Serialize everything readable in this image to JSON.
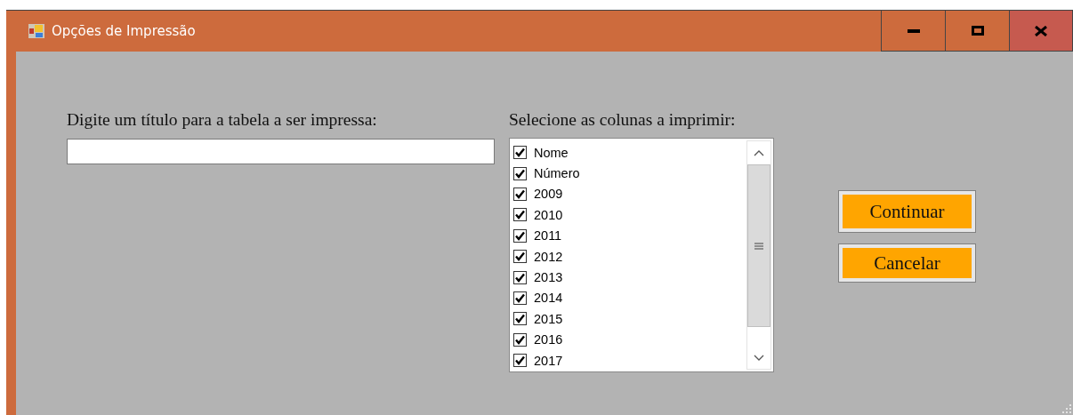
{
  "window": {
    "title": "Opções de Impressão"
  },
  "title_field": {
    "label": "Digite um título para a tabela a ser impressa:"
  },
  "columns_list": {
    "label": "Selecione as colunas a imprimir:",
    "items": [
      {
        "label": "Nome",
        "checked": true
      },
      {
        "label": "Número",
        "checked": true
      },
      {
        "label": "2009",
        "checked": true
      },
      {
        "label": "2010",
        "checked": true
      },
      {
        "label": "2011",
        "checked": true
      },
      {
        "label": "2012",
        "checked": true
      },
      {
        "label": "2013",
        "checked": true
      },
      {
        "label": "2014",
        "checked": true
      },
      {
        "label": "2015",
        "checked": true
      },
      {
        "label": "2016",
        "checked": true
      },
      {
        "label": "2017",
        "checked": true
      }
    ]
  },
  "buttons": [
    {
      "label": "Continuar"
    },
    {
      "label": "Cancelar"
    }
  ]
}
